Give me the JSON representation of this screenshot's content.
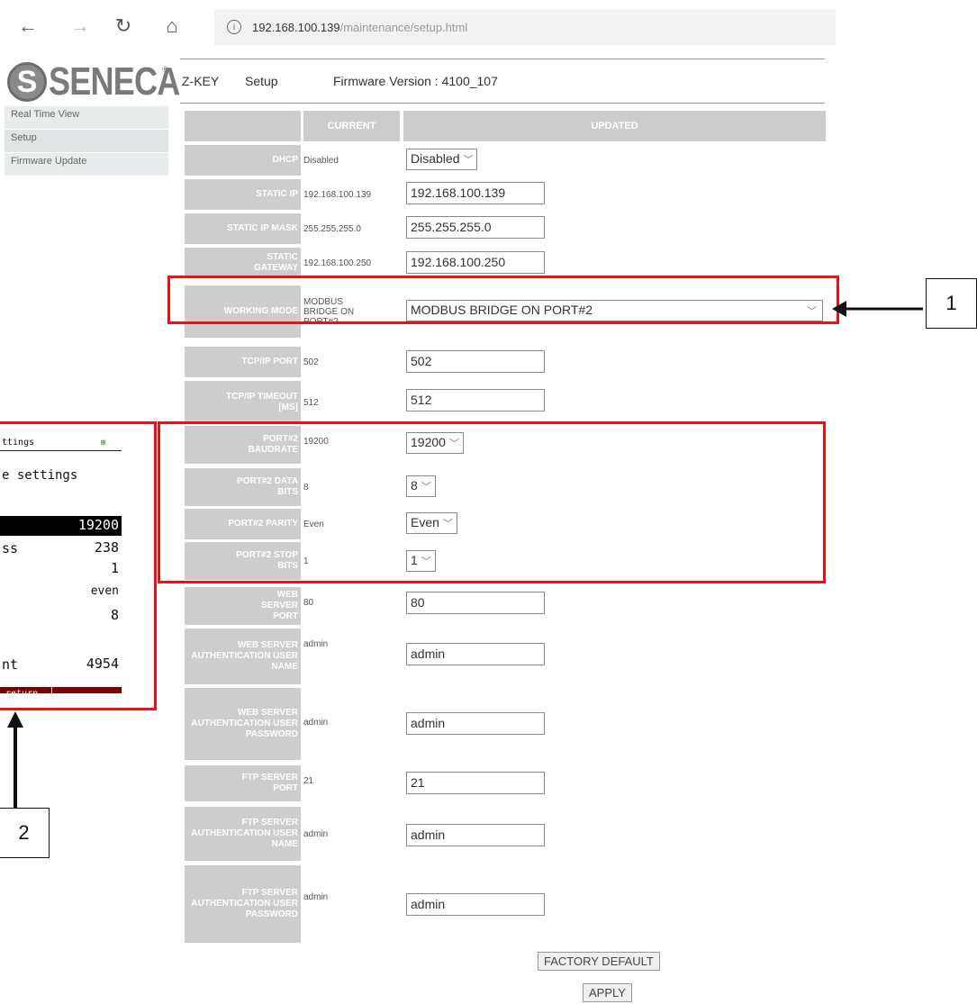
{
  "browser": {
    "back_icon": "←",
    "forward_icon": "→",
    "reload_icon": "↻",
    "home_icon": "⌂",
    "info_icon": "i",
    "url_host": "192.168.100.139",
    "url_path": "/maintenance/setup.html"
  },
  "logo": {
    "mark": "S",
    "word": "SENECA",
    "reg": "®"
  },
  "sidebar": {
    "items": [
      {
        "label": "Real Time View"
      },
      {
        "label": "Setup"
      },
      {
        "label": "Firmware Update"
      }
    ]
  },
  "header": {
    "device": "Z-KEY",
    "page": "Setup",
    "firmware": "Firmware Version : 4100_107"
  },
  "table": {
    "col_current": "CURRENT",
    "col_updated": "UPDATED",
    "rows": [
      {
        "label": "DHCP",
        "current": "Disabled",
        "updated": "Disabled"
      },
      {
        "label": "STATIC IP",
        "current": "192.168.100.139",
        "updated": "192.168.100.139"
      },
      {
        "label": "STATIC IP MASK",
        "current": "255.255.255.0",
        "updated": "255.255.255.0"
      },
      {
        "label": "STATIC GATEWAY",
        "current": "192.168.100.250",
        "updated": "192.168.100.250"
      },
      {
        "label": "WORKING MODE",
        "current": "MODBUS BRIDGE ON PORT#2",
        "updated": "MODBUS BRIDGE ON PORT#2"
      },
      {
        "label": "TCP/IP PORT",
        "current": "502",
        "updated": "502"
      },
      {
        "label": "TCP/IP TIMEOUT [ms]",
        "current": "512",
        "updated": "512"
      },
      {
        "label": "PORT#2 BAUDRATE",
        "current": "19200",
        "updated": "19200"
      },
      {
        "label": "PORT#2 DATA BITS",
        "current": "8",
        "updated": "8"
      },
      {
        "label": "PORT#2 PARITY",
        "current": "Even",
        "updated": "Even"
      },
      {
        "label": "PORT#2 STOP BITS",
        "current": "1",
        "updated": "1"
      },
      {
        "label": "WEB SERVER PORT",
        "current": "80",
        "updated": "80"
      },
      {
        "label": "WEB SERVER AUTHENTICATION USER NAME",
        "current": "admin",
        "updated": "admin"
      },
      {
        "label": "WEB SERVER AUTHENTICATION USER PASSWORD",
        "current": "admin",
        "updated": "admin"
      },
      {
        "label": "FTP SERVER PORT",
        "current": "21",
        "updated": "21"
      },
      {
        "label": "FTP SERVER AUTHENTICATION USER NAME",
        "current": "admin",
        "updated": "admin"
      },
      {
        "label": "FTP SERVER AUTHENTICATION USER PASSWORD",
        "current": "admin",
        "updated": "admin"
      }
    ]
  },
  "buttons": {
    "factory": "FACTORY DEFAULT",
    "apply": "APPLY"
  },
  "callouts": {
    "one": "1",
    "two": "2"
  },
  "lcd": {
    "title": "ttings",
    "battery": "⊞",
    "subtitle": "e settings",
    "rows": [
      {
        "label": "",
        "value": "19200"
      },
      {
        "label": "ss",
        "value": "238"
      },
      {
        "label": "",
        "value": "1"
      },
      {
        "label": "",
        "value": "even"
      },
      {
        "label": "",
        "value": "8"
      },
      {
        "label": "nt",
        "value": "4954"
      }
    ],
    "bottom": "return"
  },
  "colors": {
    "highlight": "#e3131b",
    "header_grey": "#cdcdcd",
    "lcd_bar": "#7a0000"
  }
}
